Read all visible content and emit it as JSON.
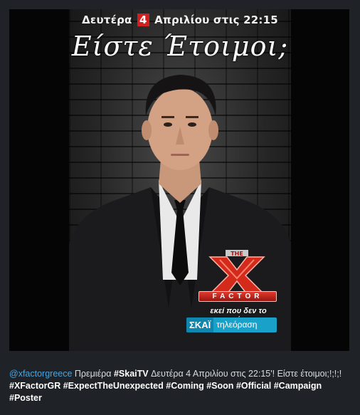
{
  "post": {
    "image": {
      "date_before": "Δευτέρα",
      "date_day": "4",
      "date_after": "Απριλίου στις 22:15",
      "headline": "Είστε Έτοιμοι;",
      "logo_top": "THE",
      "logo_word": "FACTOR",
      "tagline": "εκεί που δεν το περιμένεις...",
      "channel_brand": "ΣΚΑΪ",
      "channel_sub": "τηλεόραση"
    },
    "caption": {
      "mention": "@xfactorgreece",
      "text_1": " Πρεμιέρα ",
      "tag_1": "#SkaiTV",
      "text_2": " Δευτέρα 4 Απριλίου στις 22:15'! Είστε έτοιμοι;!;!;! ",
      "tag_2": "#XFactorGR",
      "tag_3": "#ExpectTheUnexpected",
      "tag_4": "#Coming",
      "tag_5": "#Soon",
      "tag_6": "#Official",
      "tag_7": "#Campaign",
      "tag_8": "#Poster"
    }
  },
  "colors": {
    "background": "#1f2327",
    "mention": "#4aa3df",
    "accent_red": "#d21f1f",
    "channel_blue": "#1aa1c9"
  }
}
